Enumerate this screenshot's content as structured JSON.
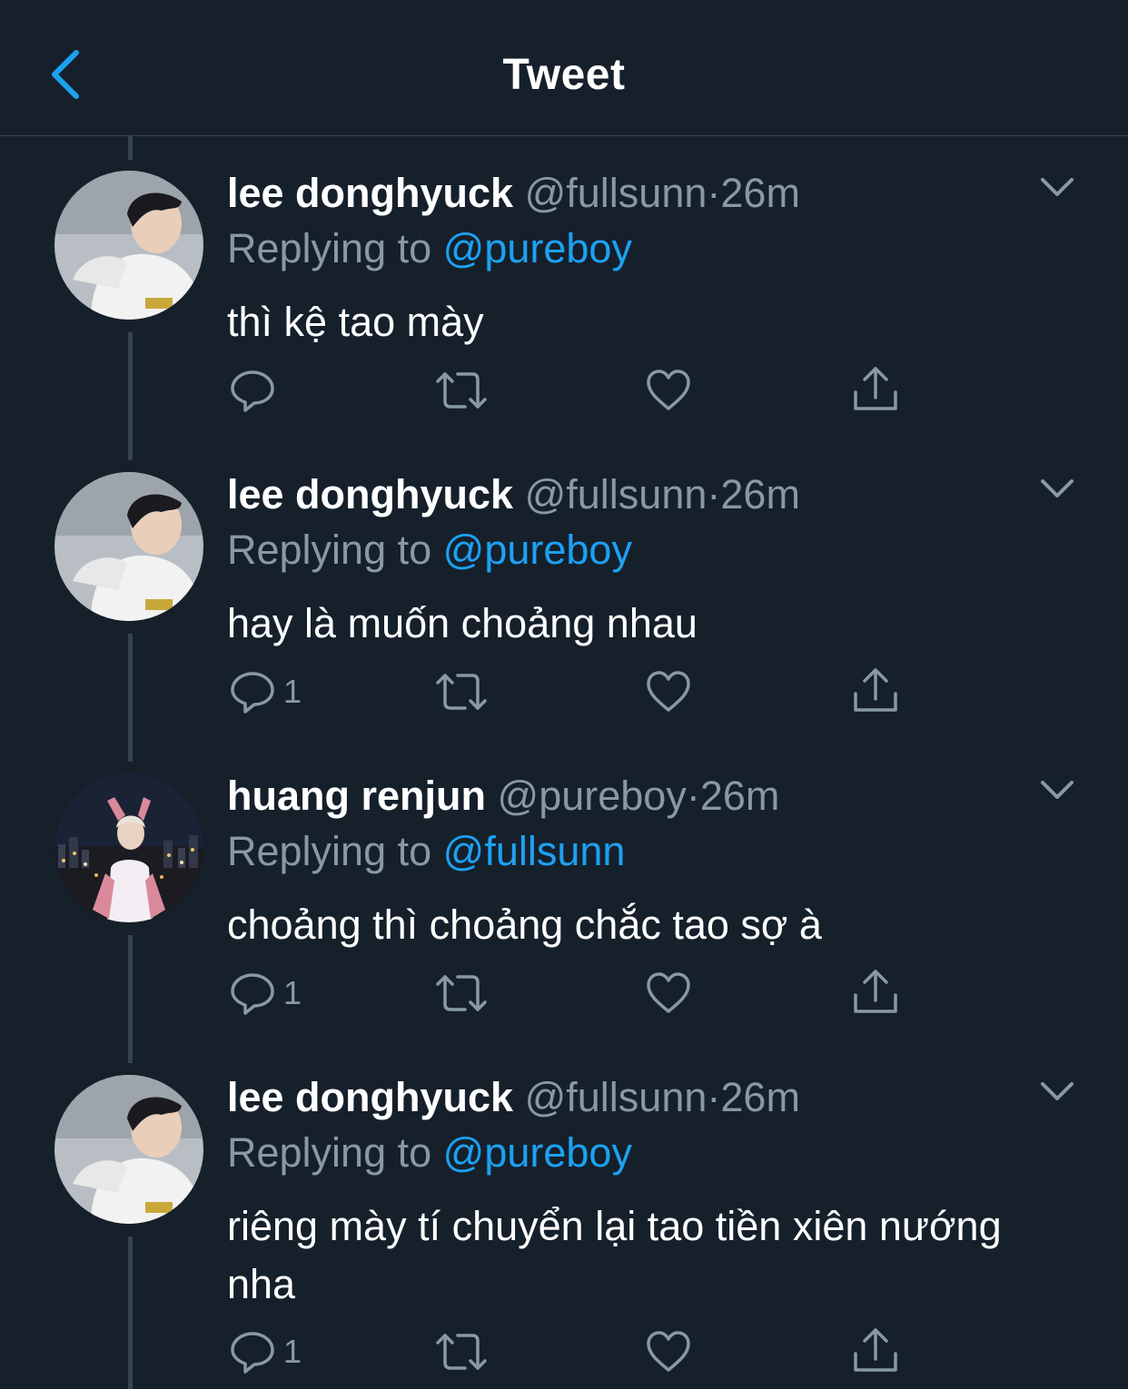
{
  "header": {
    "title": "Tweet",
    "back_icon": "chevron-left-icon"
  },
  "colors": {
    "background": "#15202b",
    "accent": "#1da1f2",
    "muted": "#8899a6",
    "divider": "#38444d"
  },
  "tweets": [
    {
      "name": "lee donghyuck",
      "handle": "@fullsunn",
      "dot": "·",
      "time": "26m",
      "replying_prefix": "Replying to",
      "replying_to": "@pureboy",
      "text": "thì kệ tao mày",
      "reply_count": ""
    },
    {
      "name": "lee donghyuck",
      "handle": "@fullsunn",
      "dot": "·",
      "time": "26m",
      "replying_prefix": "Replying to",
      "replying_to": "@pureboy",
      "text": "hay là muốn choảng nhau",
      "reply_count": "1"
    },
    {
      "name": "huang renjun",
      "handle": "@pureboy",
      "dot": "·",
      "time": "26m",
      "replying_prefix": "Replying to",
      "replying_to": "@fullsunn",
      "text": "choảng thì choảng chắc tao sợ à",
      "reply_count": "1"
    },
    {
      "name": "lee donghyuck",
      "handle": "@fullsunn",
      "dot": "·",
      "time": "26m",
      "replying_prefix": "Replying to",
      "replying_to": "@pureboy",
      "text": "riêng mày tí chuyển lại tao tiền xiên nướng nha",
      "reply_count": "1"
    }
  ],
  "action_icons": [
    "reply-icon",
    "retweet-icon",
    "like-icon",
    "share-icon"
  ]
}
